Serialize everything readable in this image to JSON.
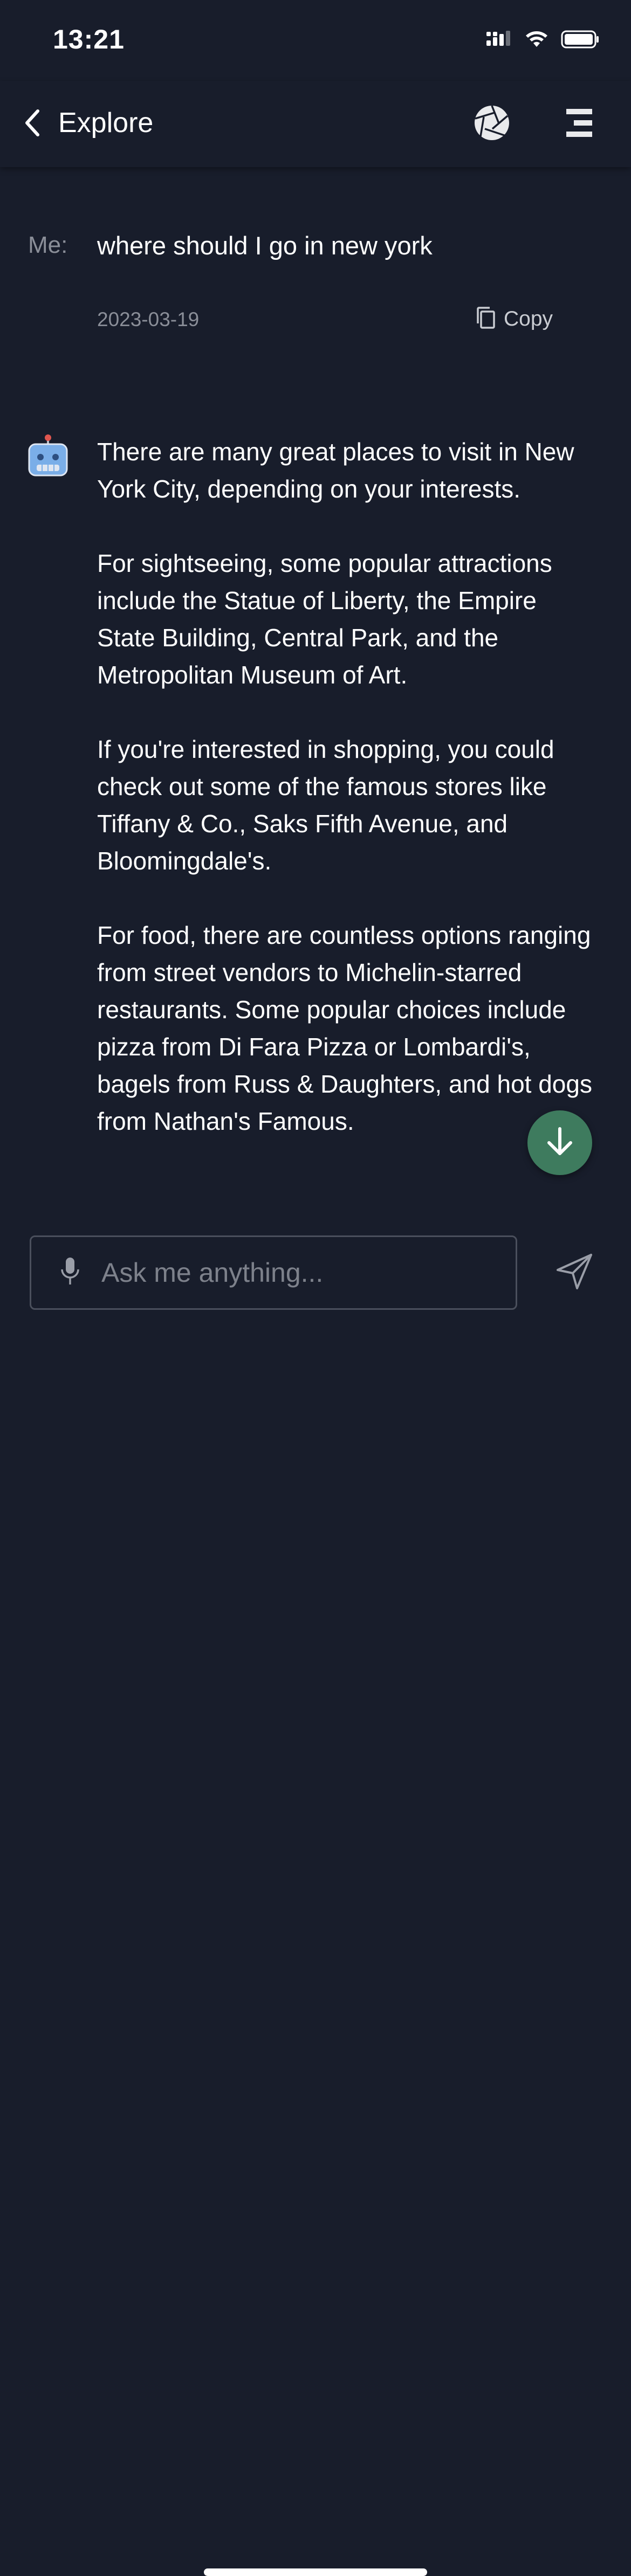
{
  "status_bar": {
    "time": "13:21"
  },
  "nav": {
    "title": "Explore"
  },
  "conversation": {
    "user_prefix": "Me:",
    "user_message": "where should I go in new york",
    "date": "2023-03-19",
    "copy_label": "Copy",
    "bot_paragraphs": [
      "There are many great places to visit in New York City, depending on your interests.",
      "For sightseeing, some popular attractions include the Statue of Liberty, the Empire State Building, Central Park, and the Metropolitan Museum of Art.",
      "If you're interested in shopping, you could check out some of the famous stores like Tiffany & Co., Saks Fifth Avenue, and Bloomingdale's.",
      "For food, there are countless options ranging from street vendors to Michelin-starred restaurants. Some popular choices include pizza from Di Fara Pizza or Lombardi's, bagels from Russ & Daughters, and hot dogs from Nathan's Famous."
    ]
  },
  "composer": {
    "placeholder": "Ask me anything...",
    "value": ""
  },
  "colors": {
    "background": "#181d2b",
    "fab": "#3e7b5e",
    "muted_text": "#8a8e98",
    "input_border": "#4a4f5c"
  },
  "icons": {
    "back": "chevron-left-icon",
    "aperture": "aperture-icon",
    "menu": "menu-icon",
    "copy": "copy-icon",
    "avatar": "robot-icon",
    "scroll_down": "arrow-down-icon",
    "mic": "microphone-icon",
    "send": "send-icon"
  }
}
